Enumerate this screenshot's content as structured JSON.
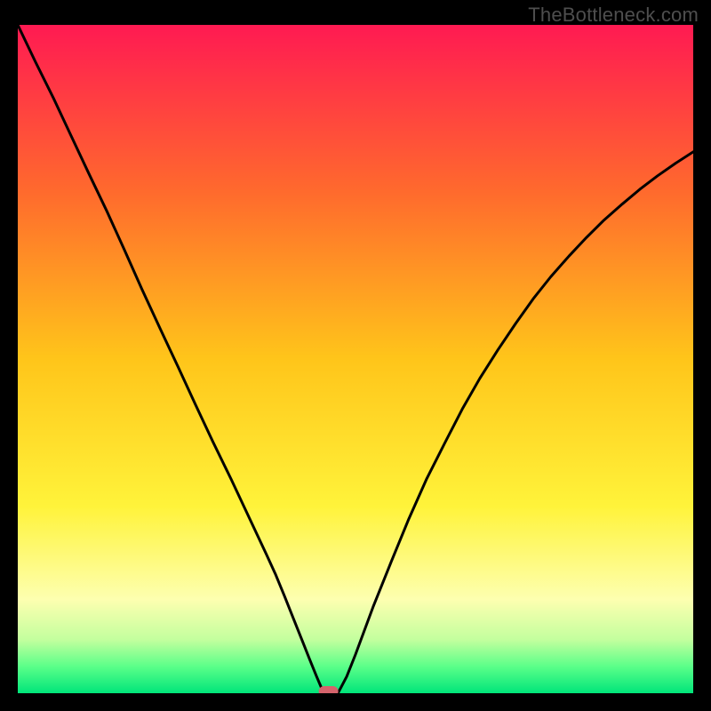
{
  "watermark": "TheBottleneck.com",
  "chart_data": {
    "type": "line",
    "title": "",
    "xlabel": "",
    "ylabel": "",
    "xlim": [
      0,
      100
    ],
    "ylim": [
      0,
      100
    ],
    "legend": false,
    "grid": false,
    "background_gradient": {
      "stops": [
        {
          "offset": 0.0,
          "color": "#ff1a52"
        },
        {
          "offset": 0.25,
          "color": "#ff6a2d"
        },
        {
          "offset": 0.5,
          "color": "#ffc51a"
        },
        {
          "offset": 0.72,
          "color": "#fff33a"
        },
        {
          "offset": 0.86,
          "color": "#fdffb0"
        },
        {
          "offset": 0.92,
          "color": "#c3ff9e"
        },
        {
          "offset": 0.96,
          "color": "#5bff89"
        },
        {
          "offset": 1.0,
          "color": "#00e57a"
        }
      ]
    },
    "series": [
      {
        "name": "bottleneck-curve",
        "color": "#000000",
        "x": [
          0.0,
          2.6,
          5.3,
          7.9,
          10.5,
          13.2,
          15.8,
          18.4,
          21.1,
          23.7,
          26.3,
          28.9,
          31.6,
          34.2,
          36.8,
          38.2,
          39.5,
          40.8,
          42.1,
          43.2,
          44.2,
          45.0,
          46.0,
          47.4,
          48.7,
          50.0,
          52.6,
          55.3,
          57.9,
          60.5,
          63.2,
          65.8,
          68.4,
          71.1,
          73.7,
          76.3,
          78.9,
          81.6,
          84.2,
          86.8,
          89.5,
          92.1,
          94.7,
          97.4,
          100.0
        ],
        "y": [
          100.0,
          94.5,
          89.0,
          83.4,
          77.8,
          72.1,
          66.3,
          60.4,
          54.5,
          48.9,
          43.2,
          37.6,
          32.0,
          26.4,
          20.8,
          17.7,
          14.5,
          11.2,
          7.9,
          5.1,
          2.6,
          0.7,
          0.0,
          0.0,
          2.5,
          5.8,
          12.9,
          19.7,
          26.1,
          32.0,
          37.4,
          42.5,
          47.1,
          51.4,
          55.3,
          59.0,
          62.3,
          65.4,
          68.2,
          70.8,
          73.2,
          75.4,
          77.4,
          79.3,
          81.0
        ]
      }
    ],
    "marker": {
      "name": "optimal-point",
      "x": 46.0,
      "y": 0.0,
      "color": "#d4636b",
      "shape": "rounded-rect"
    }
  }
}
